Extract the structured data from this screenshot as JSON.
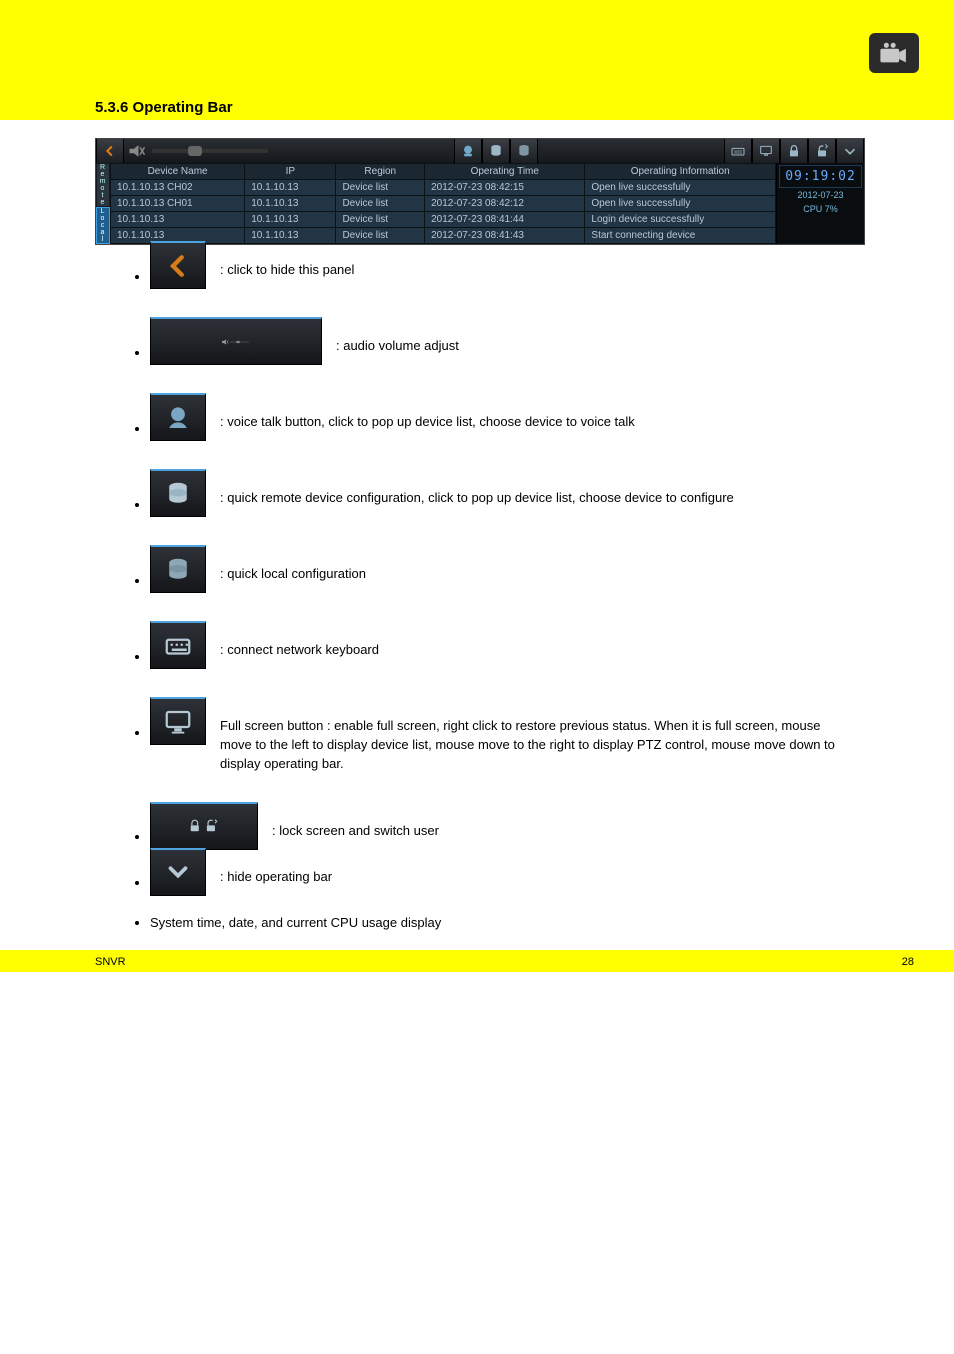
{
  "header": {
    "app_icon_name": "camera-app-icon"
  },
  "section_title": "5.3.6 Operating Bar",
  "figure": {
    "back_icon_name": "back-icon",
    "volume_icon_name": "volume-mute-icon",
    "mid_icons": [
      "voice-talk-icon",
      "db-remote-icon",
      "db-local-icon"
    ],
    "right_icons": [
      "keyboard-icon",
      "monitor-icon",
      "lock-icon",
      "switch-user-icon",
      "collapse-icon"
    ],
    "left_tabs": {
      "remote": "Remote",
      "local": "Local"
    },
    "columns": [
      "Device Name",
      "IP",
      "Region",
      "Operating Time",
      "Operatiing Information"
    ],
    "rows": [
      {
        "device_name": "10.1.10.13 CH02",
        "ip": "10.1.10.13",
        "region": "Device list",
        "time": "2012-07-23 08:42:15",
        "info": "Open live successfully"
      },
      {
        "device_name": "10.1.10.13 CH01",
        "ip": "10.1.10.13",
        "region": "Device list",
        "time": "2012-07-23 08:42:12",
        "info": "Open live successfully"
      },
      {
        "device_name": "10.1.10.13",
        "ip": "10.1.10.13",
        "region": "Device list",
        "time": "2012-07-23 08:41:44",
        "info": "Login device successfully"
      },
      {
        "device_name": "10.1.10.13",
        "ip": "10.1.10.13",
        "region": "Device list",
        "time": "2012-07-23 08:41:43",
        "info": "Start connecting device"
      }
    ],
    "clock": "09:19:02",
    "date": "2012-07-23",
    "cpu": "CPU 7%"
  },
  "features": [
    {
      "icon": "back-icon",
      "text_suffix": ": click to hide this panel"
    },
    {
      "icon": "volume-slider",
      "wide": true,
      "text_suffix": ": audio volume adjust"
    },
    {
      "icon": "voice-talk-icon",
      "text_suffix": ": voice talk button, click to pop up device list, choose device to voice talk"
    },
    {
      "icon": "db-remote-icon",
      "text_suffix": ": quick remote device configuration, click to pop up device list, choose device to configure"
    },
    {
      "icon": "db-local-icon",
      "text_suffix": ": quick local configuration"
    },
    {
      "icon": "keyboard-icon",
      "text_suffix": ": connect network keyboard"
    },
    {
      "icon": "monitor-icon",
      "text_prefix": "Full screen button ",
      "text_suffix": ": enable full screen, right click to restore previous status. When it is full screen, mouse move to the left to display device list, mouse move to the right to display PTZ control, mouse move down to display operating bar."
    },
    {
      "icon": "lock-switch-icon",
      "double": true,
      "text_suffix": ": lock screen and switch user",
      "small_gap": true
    },
    {
      "icon": "collapse-icon",
      "text_suffix": ": hide operating bar",
      "small_gap": true
    },
    {
      "icon": "none",
      "text": "System time, date, and current CPU usage display",
      "no_thumb": true,
      "small_gap": true
    }
  ],
  "footer": {
    "left": "SNVR",
    "right": "28"
  }
}
